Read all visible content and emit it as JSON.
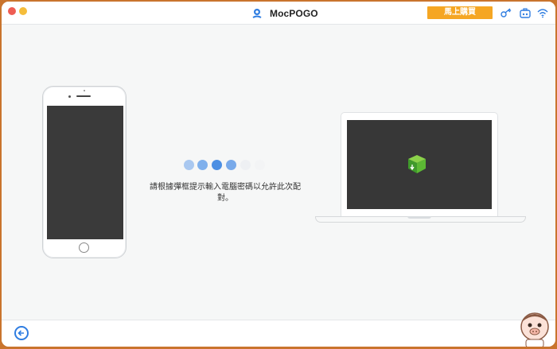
{
  "titlebar": {
    "app_name": "MocPOGO",
    "buy_label": "馬上購買",
    "icons": [
      "mocpogo-logo-icon",
      "key-icon",
      "toolbox-icon",
      "wifi-icon"
    ]
  },
  "main": {
    "loading_dots": [
      {
        "color": "#a9c8f0"
      },
      {
        "color": "#7fb0ec"
      },
      {
        "color": "#4c8fe3"
      },
      {
        "color": "#79aaea"
      },
      {
        "color": "#eef0f3"
      },
      {
        "color": "#f3f4f5"
      }
    ],
    "message": "請根據彈框提示輸入電腦密碼以允許此次配對。",
    "devices": [
      "phone-illustration",
      "laptop-illustration"
    ]
  },
  "footer": {
    "back_icon": "back-arrow-icon"
  },
  "colors": {
    "accent": "#2f7de1",
    "buy_button": "#f5a623",
    "screen_dark": "#3a3a3a",
    "desktop": "#c9742d"
  }
}
